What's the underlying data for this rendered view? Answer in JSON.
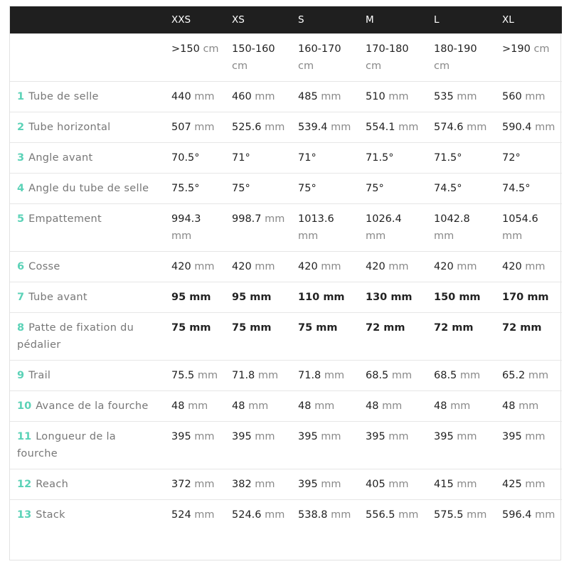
{
  "colors": {
    "header_bg": "#1f1f1f",
    "accent": "#5bd2b7",
    "label": "#777777"
  },
  "header": [
    "",
    "XXS",
    "XS",
    "S",
    "M",
    "L",
    "XL"
  ],
  "heights": [
    {
      "v": ">150",
      "u": "cm"
    },
    {
      "v": "150-160",
      "u": "cm"
    },
    {
      "v": "160-170",
      "u": "cm"
    },
    {
      "v": "170-180",
      "u": "cm"
    },
    {
      "v": "180-190",
      "u": "cm"
    },
    {
      "v": ">190",
      "u": "cm"
    }
  ],
  "rows": [
    {
      "n": "1",
      "label": "Tube de selle",
      "cells": [
        {
          "v": "440",
          "u": "mm"
        },
        {
          "v": "460",
          "u": "mm"
        },
        {
          "v": "485",
          "u": "mm"
        },
        {
          "v": "510",
          "u": "mm"
        },
        {
          "v": "535",
          "u": "mm"
        },
        {
          "v": "560",
          "u": "mm"
        }
      ]
    },
    {
      "n": "2",
      "label": "Tube horizontal",
      "cells": [
        {
          "v": "507",
          "u": "mm"
        },
        {
          "v": "525.6",
          "u": "mm"
        },
        {
          "v": "539.4",
          "u": "mm"
        },
        {
          "v": "554.1",
          "u": "mm"
        },
        {
          "v": "574.6",
          "u": "mm"
        },
        {
          "v": "590.4",
          "u": "mm"
        }
      ]
    },
    {
      "n": "3",
      "label": "Angle avant",
      "cells": [
        {
          "v": "70.5°",
          "u": ""
        },
        {
          "v": "71°",
          "u": ""
        },
        {
          "v": "71°",
          "u": ""
        },
        {
          "v": "71.5°",
          "u": ""
        },
        {
          "v": "71.5°",
          "u": ""
        },
        {
          "v": "72°",
          "u": ""
        }
      ]
    },
    {
      "n": "4",
      "label": "Angle du tube de selle",
      "cells": [
        {
          "v": "75.5°",
          "u": ""
        },
        {
          "v": "75°",
          "u": ""
        },
        {
          "v": "75°",
          "u": ""
        },
        {
          "v": "75°",
          "u": ""
        },
        {
          "v": "74.5°",
          "u": ""
        },
        {
          "v": "74.5°",
          "u": ""
        }
      ]
    },
    {
      "n": "5",
      "label": "Empattement",
      "cells": [
        {
          "v": "994.3",
          "u": "mm"
        },
        {
          "v": "998.7",
          "u": "mm"
        },
        {
          "v": "1013.6",
          "u": "mm"
        },
        {
          "v": "1026.4",
          "u": "mm"
        },
        {
          "v": "1042.8",
          "u": "mm"
        },
        {
          "v": "1054.6",
          "u": "mm"
        }
      ]
    },
    {
      "n": "6",
      "label": "Cosse",
      "cells": [
        {
          "v": "420",
          "u": "mm"
        },
        {
          "v": "420",
          "u": "mm"
        },
        {
          "v": "420",
          "u": "mm"
        },
        {
          "v": "420",
          "u": "mm"
        },
        {
          "v": "420",
          "u": "mm"
        },
        {
          "v": "420",
          "u": "mm"
        }
      ]
    },
    {
      "n": "7",
      "label": "Tube avant",
      "bold": true,
      "cells": [
        {
          "v": "95 mm",
          "u": ""
        },
        {
          "v": "95 mm",
          "u": ""
        },
        {
          "v": "110 mm",
          "u": ""
        },
        {
          "v": "130 mm",
          "u": ""
        },
        {
          "v": "150 mm",
          "u": ""
        },
        {
          "v": "170 mm",
          "u": ""
        }
      ]
    },
    {
      "n": "8",
      "label": "Patte de fixation du pédalier",
      "bold": true,
      "cells": [
        {
          "v": "75 mm",
          "u": ""
        },
        {
          "v": "75 mm",
          "u": ""
        },
        {
          "v": "75 mm",
          "u": ""
        },
        {
          "v": "72 mm",
          "u": ""
        },
        {
          "v": "72 mm",
          "u": ""
        },
        {
          "v": "72 mm",
          "u": ""
        }
      ]
    },
    {
      "n": "9",
      "label": "Trail",
      "cells": [
        {
          "v": "75.5",
          "u": "mm"
        },
        {
          "v": "71.8",
          "u": "mm"
        },
        {
          "v": "71.8",
          "u": "mm"
        },
        {
          "v": "68.5",
          "u": "mm"
        },
        {
          "v": "68.5",
          "u": "mm"
        },
        {
          "v": "65.2",
          "u": "mm"
        }
      ]
    },
    {
      "n": "10",
      "label": "Avance de la fourche",
      "cells": [
        {
          "v": "48",
          "u": "mm"
        },
        {
          "v": "48",
          "u": "mm"
        },
        {
          "v": "48",
          "u": "mm"
        },
        {
          "v": "48",
          "u": "mm"
        },
        {
          "v": "48",
          "u": "mm"
        },
        {
          "v": "48",
          "u": "mm"
        }
      ]
    },
    {
      "n": "11",
      "label": "Longueur de la fourche",
      "cells": [
        {
          "v": "395",
          "u": "mm"
        },
        {
          "v": "395",
          "u": "mm"
        },
        {
          "v": "395",
          "u": "mm"
        },
        {
          "v": "395",
          "u": "mm"
        },
        {
          "v": "395",
          "u": "mm"
        },
        {
          "v": "395",
          "u": "mm"
        }
      ]
    },
    {
      "n": "12",
      "label": "Reach",
      "cells": [
        {
          "v": "372",
          "u": "mm"
        },
        {
          "v": "382",
          "u": "mm"
        },
        {
          "v": "395",
          "u": "mm"
        },
        {
          "v": "405",
          "u": "mm"
        },
        {
          "v": "415",
          "u": "mm"
        },
        {
          "v": "425",
          "u": "mm"
        }
      ]
    },
    {
      "n": "13",
      "label": "Stack",
      "cells": [
        {
          "v": "524",
          "u": "mm"
        },
        {
          "v": "524.6",
          "u": "mm"
        },
        {
          "v": "538.8",
          "u": "mm"
        },
        {
          "v": "556.5",
          "u": "mm"
        },
        {
          "v": "575.5",
          "u": "mm"
        },
        {
          "v": "596.4",
          "u": "mm"
        }
      ]
    }
  ]
}
